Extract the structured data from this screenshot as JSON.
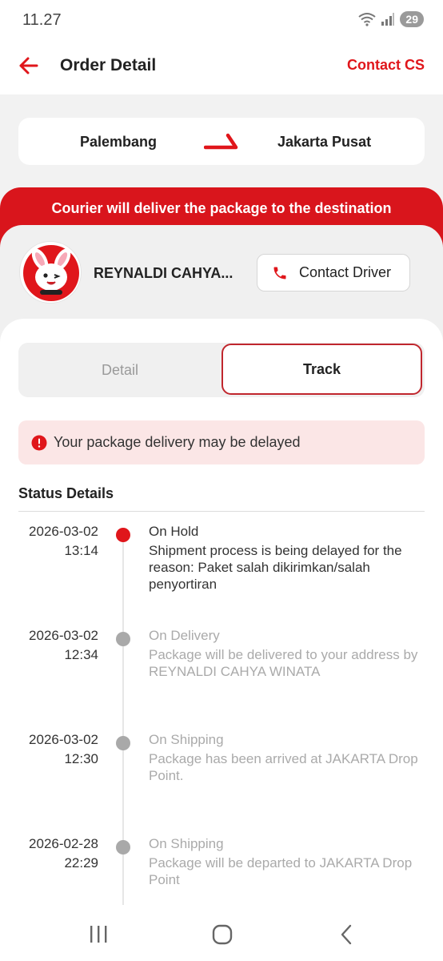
{
  "status_bar": {
    "time": "11.27",
    "battery": "29"
  },
  "header": {
    "title": "Order Detail",
    "contact_cs": "Contact CS"
  },
  "route": {
    "from": "Palembang",
    "to": "Jakarta Pusat"
  },
  "banner": {
    "text": "Courier will deliver the package to the destination"
  },
  "driver": {
    "name": "REYNALDI CAHYA...",
    "contact_button": "Contact Driver"
  },
  "tabs": [
    {
      "label": "Detail",
      "active": false
    },
    {
      "label": "Track",
      "active": true
    }
  ],
  "alert": {
    "text": "Your package delivery may be delayed"
  },
  "status_details": {
    "title": "Status Details",
    "items": [
      {
        "date": "2026-03-02",
        "time": "13:14",
        "status": "On Hold",
        "description": "Shipment process is being delayed for the reason: Paket salah dikirimkan/salah penyortiran",
        "active": true
      },
      {
        "date": "2026-03-02",
        "time": "12:34",
        "status": "On Delivery",
        "description": "Package will be delivered to your address by REYNALDI CAHYA WINATA",
        "active": false
      },
      {
        "date": "2026-03-02",
        "time": "12:30",
        "status": "On Shipping",
        "description": "Package has been arrived at JAKARTA Drop Point.",
        "active": false
      },
      {
        "date": "2026-02-28",
        "time": "22:29",
        "status": "On Shipping",
        "description": "Package will be departed to JAKARTA Drop Point",
        "active": false
      }
    ]
  },
  "colors": {
    "brand_red": "#e0161b",
    "banner_red": "#d9151c",
    "alert_bg": "#fbe6e6"
  }
}
